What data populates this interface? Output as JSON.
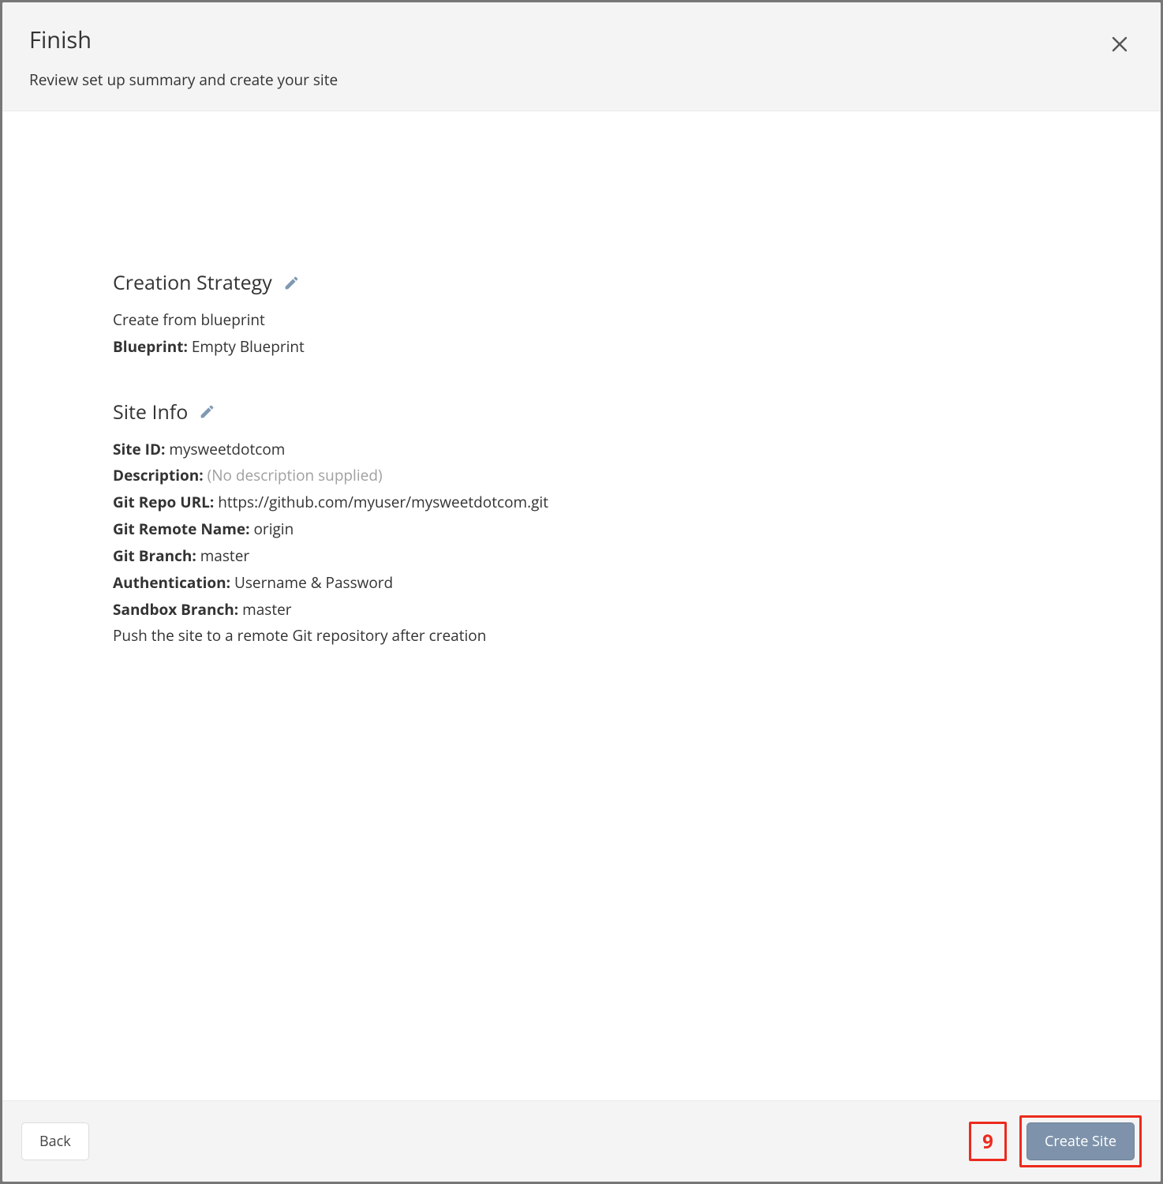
{
  "header": {
    "title": "Finish",
    "subtitle": "Review set up summary and create your site"
  },
  "creation_strategy": {
    "heading": "Creation Strategy",
    "line1": "Create from blueprint",
    "blueprint_label": "Blueprint:",
    "blueprint_value": "Empty Blueprint"
  },
  "site_info": {
    "heading": "Site Info",
    "site_id_label": "Site ID:",
    "site_id_value": "mysweetdotcom",
    "description_label": "Description:",
    "description_value": "(No description supplied)",
    "git_repo_url_label": "Git Repo URL:",
    "git_repo_url_value": "https://github.com/myuser/mysweetdotcom.git",
    "git_remote_name_label": "Git Remote Name:",
    "git_remote_name_value": "origin",
    "git_branch_label": "Git Branch:",
    "git_branch_value": "master",
    "authentication_label": "Authentication:",
    "authentication_value": "Username & Password",
    "sandbox_branch_label": "Sandbox Branch:",
    "sandbox_branch_value": "master",
    "push_note": "Push the site to a remote Git repository after creation"
  },
  "footer": {
    "back_label": "Back",
    "create_label": "Create Site",
    "annotation_number": "9"
  }
}
